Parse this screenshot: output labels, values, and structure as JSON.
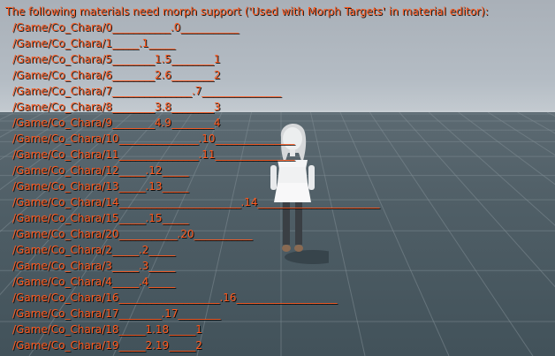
{
  "message": {
    "header": "The following materials need morph support ('Used with Morph Targets' in material editor):",
    "materials": [
      "/Game/Co_Chara/0___________.0___________",
      "/Game/Co_Chara/1_____.1_____",
      "/Game/Co_Chara/5________1.5________1",
      "/Game/Co_Chara/6________2.6________2",
      "/Game/Co_Chara/7_______________.7_______________",
      "/Game/Co_Chara/8________3.8________3",
      "/Game/Co_Chara/9________4.9________4",
      "/Game/Co_Chara/10_______________.10_______________",
      "/Game/Co_Chara/11_______________.11_______________",
      "/Game/Co_Chara/12_____.12_____",
      "/Game/Co_Chara/13_____.13_____",
      "/Game/Co_Chara/14_______________________.14_______________________",
      "/Game/Co_Chara/15_____.15_____",
      "/Game/Co_Chara/20___________.20___________",
      "/Game/Co_Chara/2_____.2_____",
      "/Game/Co_Chara/3_____.3_____",
      "/Game/Co_Chara/4_____.4_____",
      "/Game/Co_Chara/16___________________.16___________________",
      "/Game/Co_Chara/17________.17________",
      "/Game/Co_Chara/18_____1.18_____1",
      "/Game/Co_Chara/19_____2.19_____2"
    ]
  },
  "colors": {
    "message_text": "#ff5a1f",
    "sky": "#b4bcc4",
    "floor": "#4f5e66"
  }
}
